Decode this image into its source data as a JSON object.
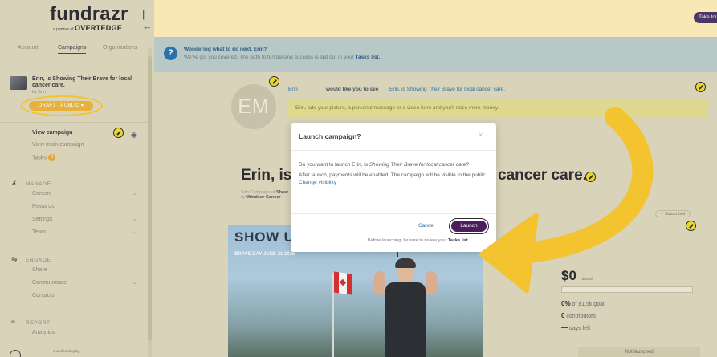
{
  "sidebar": {
    "logo_main": "fundrazr",
    "logo_partner": "a partner of",
    "logo_brand": "OVERTEDGE",
    "tabs": [
      "Account",
      "Campaigns",
      "Organizations"
    ],
    "campaign_title": "Erin, is Showing Their Brave for local cancer care.",
    "campaign_sub": "by Erin",
    "status_label": "DRAFT · PUBLIC ▾",
    "view_campaign": "View campaign",
    "view_main_campaign": "View main campaign",
    "tasks_label": "Tasks",
    "tasks_count": "3",
    "manage_head": "MANAGE",
    "manage_items": [
      "Content",
      "Rewards",
      "Settings",
      "Team"
    ],
    "engage_head": "ENGAGE",
    "engage_items": [
      "Share",
      "Communicate",
      "Contacts"
    ],
    "report_head": "REPORT",
    "report_items": [
      "Analytics"
    ],
    "footer_text": "crowdfunding by"
  },
  "header": {
    "take_tour_label": "Take tour"
  },
  "help_bar": {
    "title": "Wondering what to do next, Erin?",
    "text_prefix": "We've got you covered. The path to fundraising success is laid out in your ",
    "text_link": "Tasks list."
  },
  "campaign_page": {
    "avatar_initials": "EM",
    "bubble_name": "Erin",
    "bubble_prefix": "would like you to see",
    "bubble_link": "Erin, is Showing Their Brave for local cancer care.",
    "bubble_tip": "Erin, add your picture, a personal message or a video here and you'll raise more money.",
    "title_left": "Erin, is S",
    "title_right": "cancer care.",
    "sub_prefix": "Sub Campaign of",
    "sub_campaign": "Show",
    "sub_by_prefix": "by",
    "sub_org": "Windsor Cancer",
    "subscribed_badge": "✓ Subscribed",
    "hero_title": "SHOW US YOUR BRAVE",
    "hero_subtitle": "BRAVE DAY JUNE 21 2025",
    "raised_amount": "$0",
    "raised_label": "raised",
    "progress_fraction": 0,
    "goal_percent": "0%",
    "goal_text": "of $1.5k goal",
    "contributors_count": "0",
    "contributors_label": "contributors",
    "days_left": "—",
    "days_left_label": "days left",
    "not_launched": "Not launched"
  },
  "modal": {
    "title": "Launch campaign?",
    "close_glyph": "×",
    "question_prefix": "Do you want to launch Erin, is ",
    "question_italic": "Showing Their Brave for local cancer care",
    "question_suffix": "?",
    "info_text": "After launch, payments will be enabled. The campaign will be visible to the public.",
    "visibility_link": "Change visibility",
    "cancel_label": "Cancel",
    "launch_label": "Launch",
    "note_prefix": "Before launching, be sure to review your ",
    "note_link": "Tasks list"
  },
  "colors": {
    "accent_purple": "#4c1f5c",
    "highlight_yellow": "#f3c430",
    "link_blue": "#2a72a8",
    "status_orange": "#e8b03c"
  }
}
